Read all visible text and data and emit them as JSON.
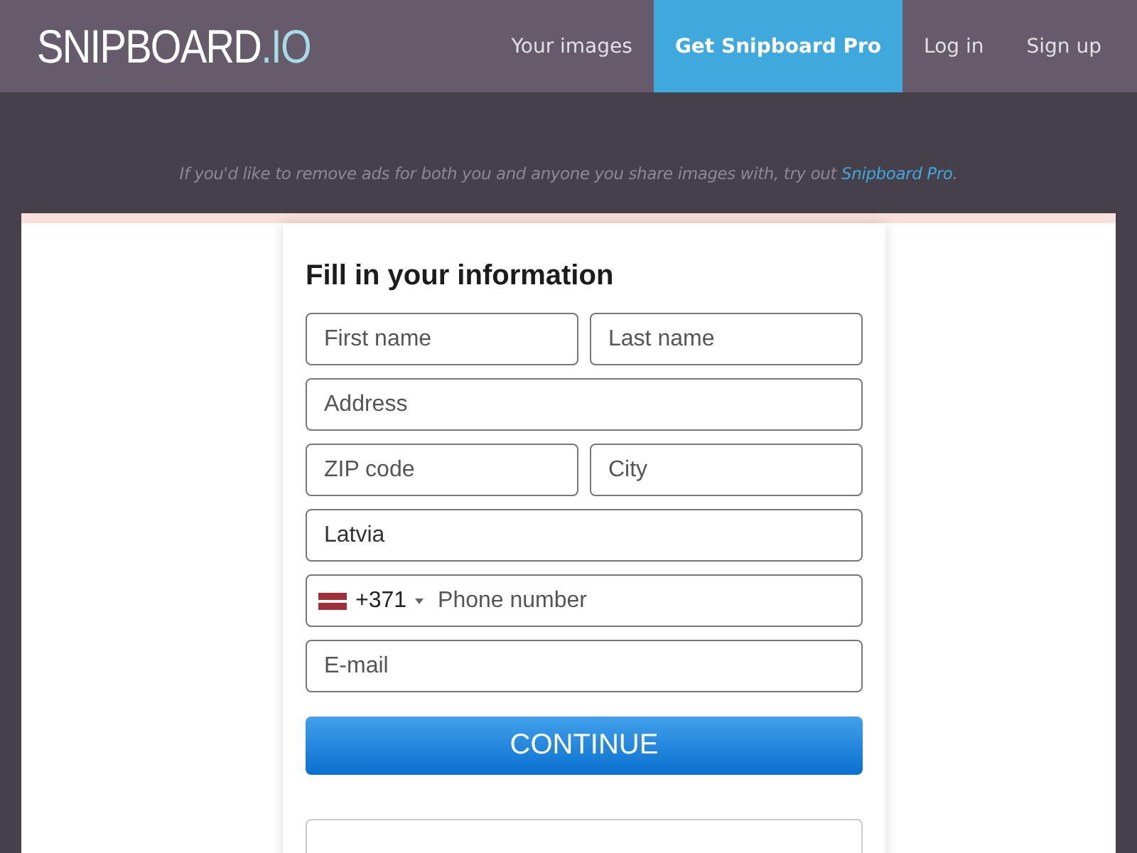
{
  "header": {
    "logo": {
      "name": "SNIPBOARD",
      "suffix": ".IO"
    },
    "nav": [
      {
        "label": "Your images",
        "selected": false
      },
      {
        "label": "Get Snipboard Pro",
        "selected": true
      },
      {
        "label": "Log in",
        "selected": false
      },
      {
        "label": "Sign up",
        "selected": false
      }
    ]
  },
  "notice": {
    "before": "If you'd like to remove ads for both you and anyone you share images with, try out ",
    "link": "Snipboard Pro",
    "after": "."
  },
  "form": {
    "title": "Fill in your information",
    "rows": [
      [
        {
          "kind": "text",
          "placeholder": "First name"
        },
        {
          "kind": "text",
          "placeholder": "Last name"
        }
      ],
      [
        {
          "kind": "text",
          "placeholder": "Address"
        }
      ],
      [
        {
          "kind": "text",
          "placeholder": "ZIP code"
        },
        {
          "kind": "text",
          "placeholder": "City"
        }
      ],
      [
        {
          "kind": "select",
          "value": "Latvia"
        }
      ],
      [
        {
          "kind": "phone",
          "code": "+371",
          "placeholder": "Phone number"
        }
      ],
      [
        {
          "kind": "text",
          "placeholder": "E-mail"
        }
      ]
    ],
    "button": "CONTINUE"
  }
}
